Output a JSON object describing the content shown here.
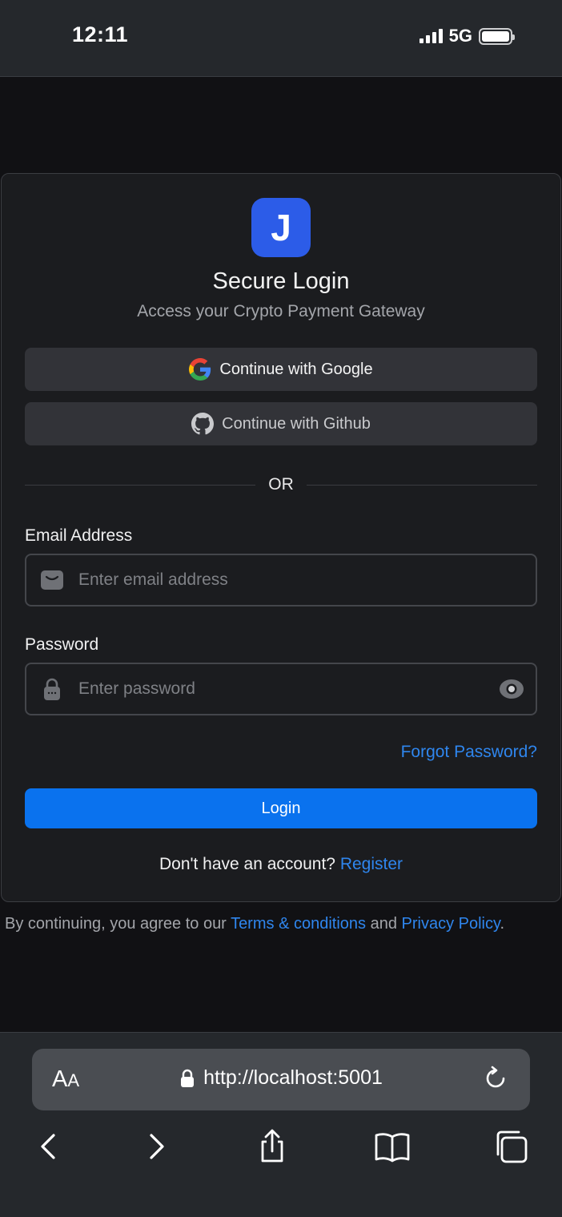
{
  "status_bar": {
    "time": "12:11",
    "network": "5G"
  },
  "login_card": {
    "logo_letter": "J",
    "title": "Secure Login",
    "subtitle": "Access your Crypto Payment Gateway",
    "google_button": "Continue with Google",
    "github_button": "Continue with Github",
    "divider_text": "OR",
    "email": {
      "label": "Email Address",
      "placeholder": "Enter email address",
      "value": ""
    },
    "password": {
      "label": "Password",
      "placeholder": "Enter password",
      "value": ""
    },
    "forgot_password": "Forgot Password?",
    "login_button": "Login",
    "register_prompt": "Don't have an account?",
    "register_link": "Register"
  },
  "legal": {
    "prefix": "By continuing, you agree to our",
    "terms_link": "Terms & conditions",
    "and": "and",
    "privacy_link": "Privacy Policy",
    "suffix": "."
  },
  "browser": {
    "url": "http://localhost:5001",
    "icons": [
      "text-size-icon",
      "lock-icon",
      "reload-icon",
      "back-icon",
      "forward-icon",
      "share-icon",
      "bookmarks-icon",
      "tabs-icon"
    ]
  },
  "colors": {
    "accent": "#0a72ee",
    "link": "#2f86ee",
    "logo": "#2c5ce8",
    "card_background": "#1b1c1f",
    "page_background": "#111114"
  }
}
